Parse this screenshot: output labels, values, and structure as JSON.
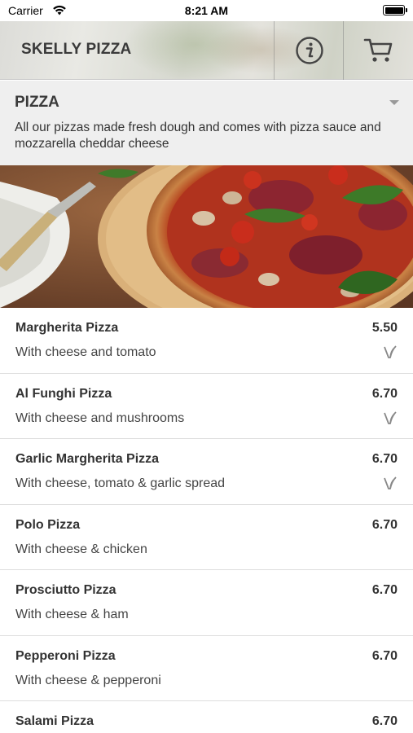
{
  "status_bar": {
    "carrier": "Carrier",
    "time": "8:21 AM"
  },
  "header": {
    "brand": "SKELLY PIZZA",
    "info_icon": "info-circle-icon",
    "cart_icon": "cart-icon"
  },
  "category": {
    "title": "PIZZA",
    "toggle_icon": "caret-down-icon",
    "description": "All our pizzas made fresh dough and comes with pizza sauce and mozzarella cheddar cheese"
  },
  "items": [
    {
      "name": "Margherita Pizza",
      "price": "5.50",
      "description": "With cheese and tomato",
      "vegetarian": true
    },
    {
      "name": "Al Funghi Pizza",
      "price": "6.70",
      "description": "With cheese and mushrooms",
      "vegetarian": true
    },
    {
      "name": "Garlic Margherita Pizza",
      "price": "6.70",
      "description": "With cheese, tomato & garlic spread",
      "vegetarian": true
    },
    {
      "name": "Polo Pizza",
      "price": "6.70",
      "description": "With cheese & chicken",
      "vegetarian": false
    },
    {
      "name": "Prosciutto Pizza",
      "price": "6.70",
      "description": "With cheese & ham",
      "vegetarian": false
    },
    {
      "name": "Pepperoni Pizza",
      "price": "6.70",
      "description": "With cheese & pepperoni",
      "vegetarian": false
    },
    {
      "name": "Salami Pizza",
      "price": "6.70",
      "description": "",
      "vegetarian": false
    }
  ],
  "colors": {
    "text_dark": "#333333",
    "category_bg": "#efefef",
    "divider": "#dedede",
    "veg_icon": "#888888"
  }
}
